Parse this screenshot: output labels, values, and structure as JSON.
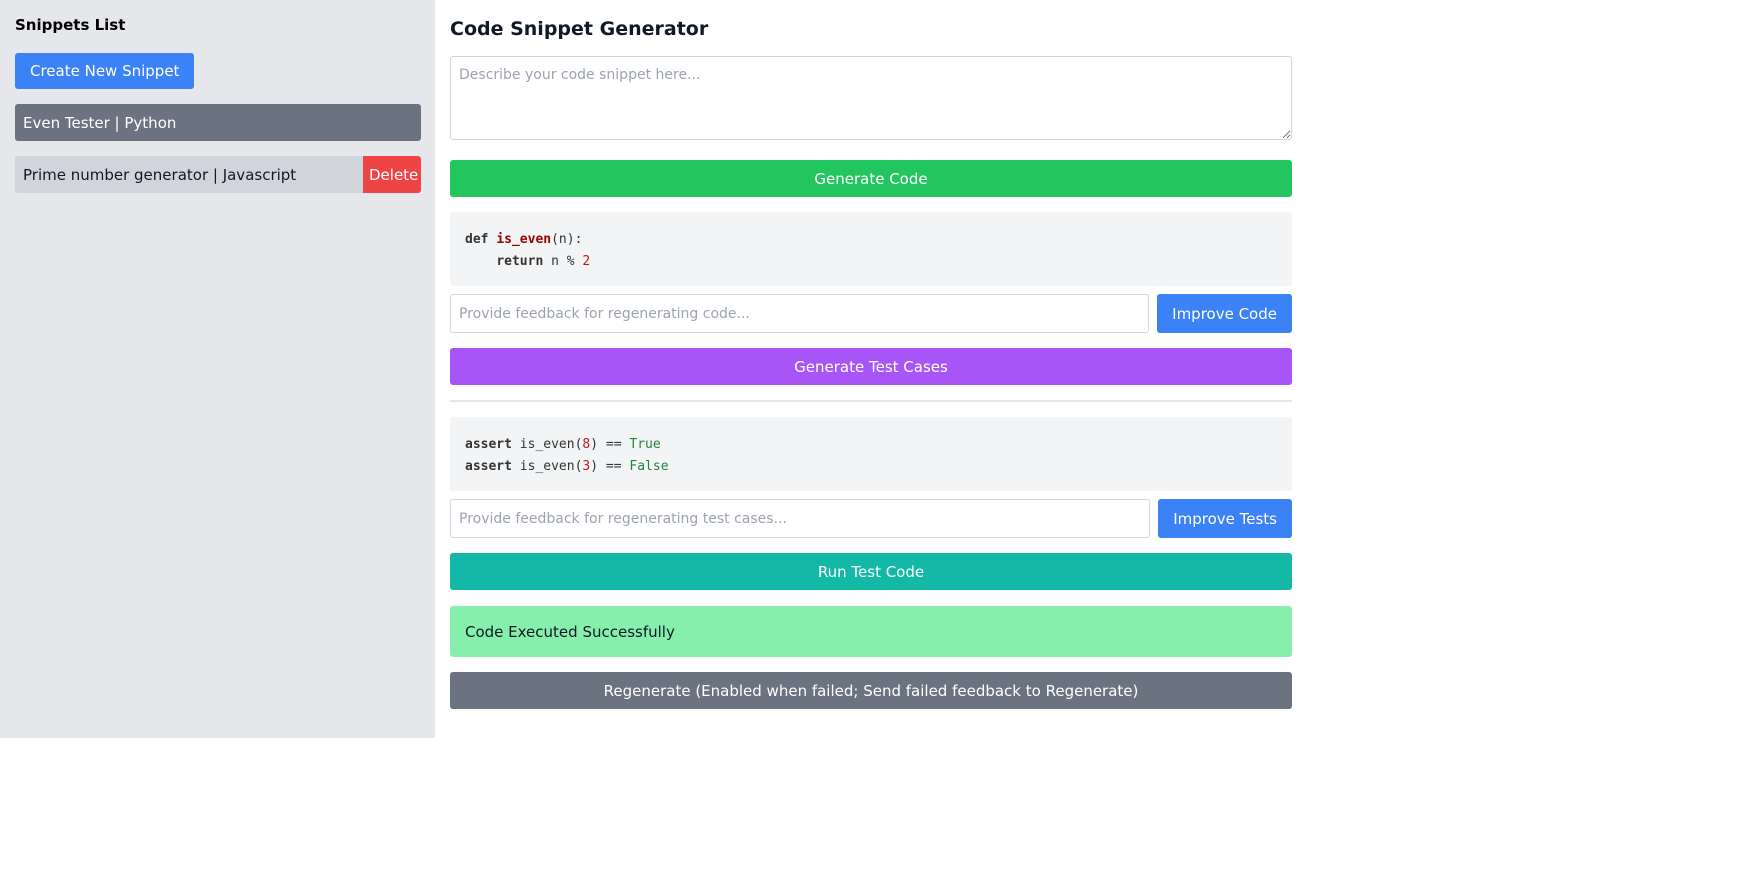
{
  "sidebar": {
    "title": "Snippets List",
    "create_label": "Create New Snippet",
    "items": [
      {
        "label": "Even Tester | Python",
        "active": true
      },
      {
        "label": "Prime number generator | Javascript",
        "active": false,
        "delete_label": "Delete"
      }
    ]
  },
  "main": {
    "title": "Code Snippet Generator",
    "description_placeholder": "Describe your code snippet here...",
    "generate_code_label": "Generate Code",
    "code_lines": {
      "line1": {
        "kw": "def",
        "fn": "is_even",
        "rest": "(n):"
      },
      "line2": {
        "indent": "    ",
        "kw": "return",
        "rest1": " n % ",
        "num": "2"
      }
    },
    "code_feedback_placeholder": "Provide feedback for regenerating code...",
    "improve_code_label": "Improve Code",
    "generate_tests_label": "Generate Test Cases",
    "test_lines": {
      "line1": {
        "kw": "assert",
        "call": " is_even(",
        "num": "8",
        "rest": ") == ",
        "lit": "True"
      },
      "line2": {
        "kw": "assert",
        "call": " is_even(",
        "num": "3",
        "rest": ") == ",
        "lit": "False"
      }
    },
    "tests_feedback_placeholder": "Provide feedback for regenerating test cases...",
    "improve_tests_label": "Improve Tests",
    "run_label": "Run Test Code",
    "status_text": "Code Executed Successfully",
    "regenerate_label": "Regenerate (Enabled when failed; Send failed feedback to Regenerate)"
  },
  "colors": {
    "sidebar_bg": "#e5e7eb",
    "primary": "#3b82f6",
    "success": "#22c55e",
    "purple": "#a855f7",
    "teal": "#14b8a6",
    "danger": "#ef4444",
    "neutral": "#6b7280",
    "status_success_bg": "#86efac"
  }
}
